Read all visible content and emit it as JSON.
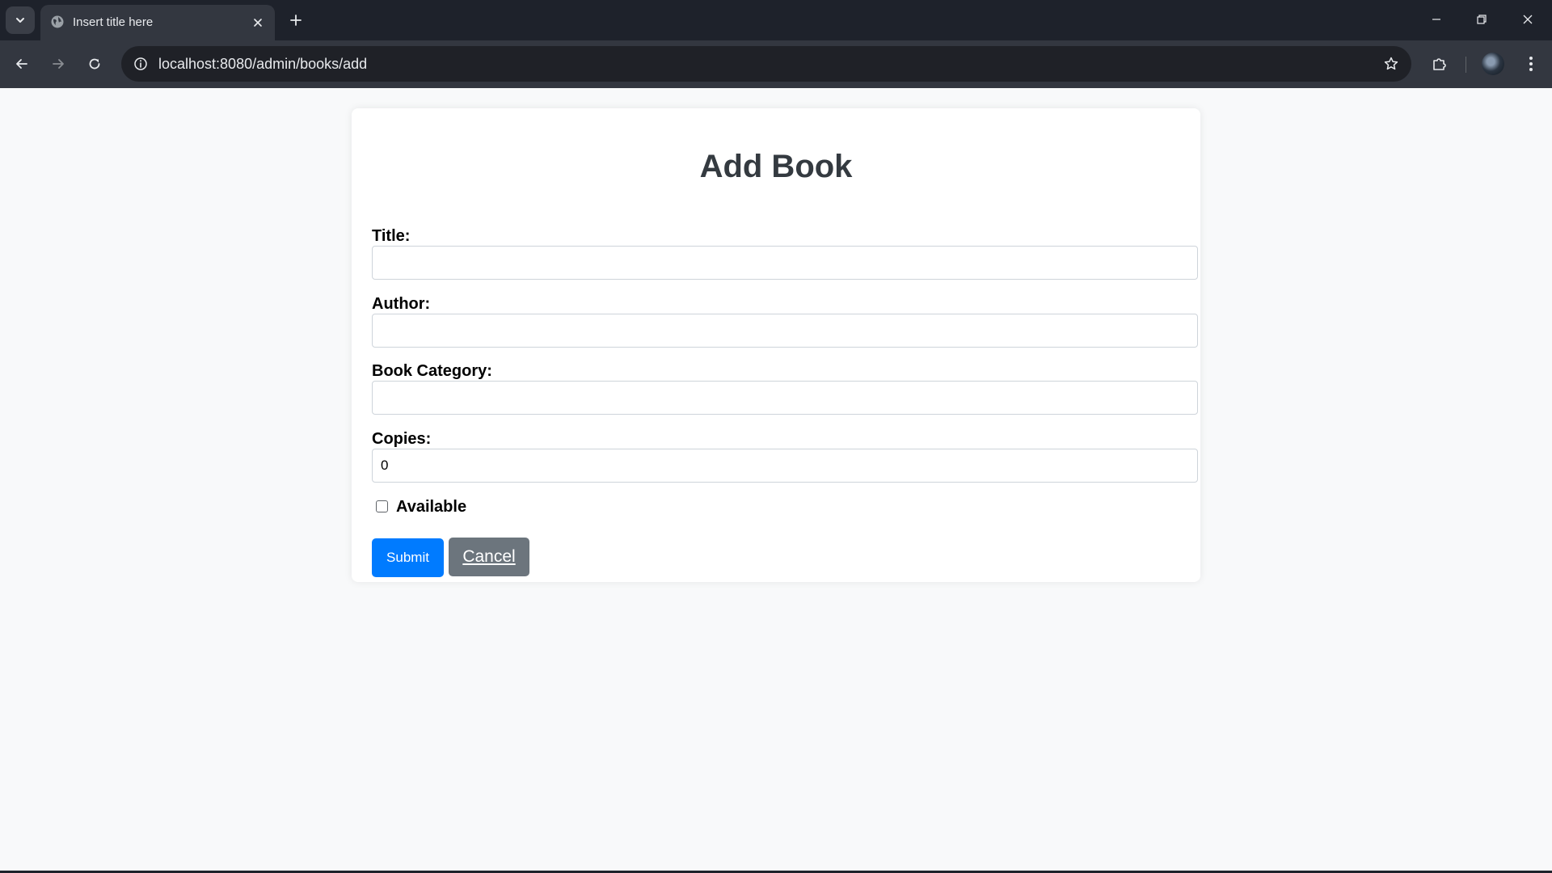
{
  "browser": {
    "tab_title": "Insert title here",
    "url": "localhost:8080/admin/books/add",
    "icons": {
      "tab_search": "chevron-down-icon",
      "favicon": "globe-icon",
      "tab_close": "close-icon",
      "new_tab": "plus-icon",
      "back": "arrow-left-icon",
      "forward": "arrow-right-icon",
      "reload": "reload-icon",
      "site_info": "info-icon",
      "bookmark": "star-icon",
      "extensions": "puzzle-icon",
      "profile": "avatar",
      "menu": "kebab-icon",
      "minimize": "minimize-icon",
      "restore": "restore-icon",
      "close_window": "close-icon"
    }
  },
  "page": {
    "heading": "Add Book",
    "fields": [
      {
        "label": "Title:",
        "value": ""
      },
      {
        "label": "Author:",
        "value": ""
      },
      {
        "label": "Book Category:",
        "value": ""
      },
      {
        "label": "Copies:",
        "value": "0"
      }
    ],
    "available_label": "Available",
    "available_checked": false,
    "submit_label": "Submit",
    "cancel_label": "Cancel"
  },
  "colors": {
    "chrome_dark": "#1e222b",
    "toolbar": "#333740",
    "page_bg": "#f8f9fa",
    "heading": "#343a40",
    "submit": "#007bff",
    "cancel": "#6c757d"
  }
}
